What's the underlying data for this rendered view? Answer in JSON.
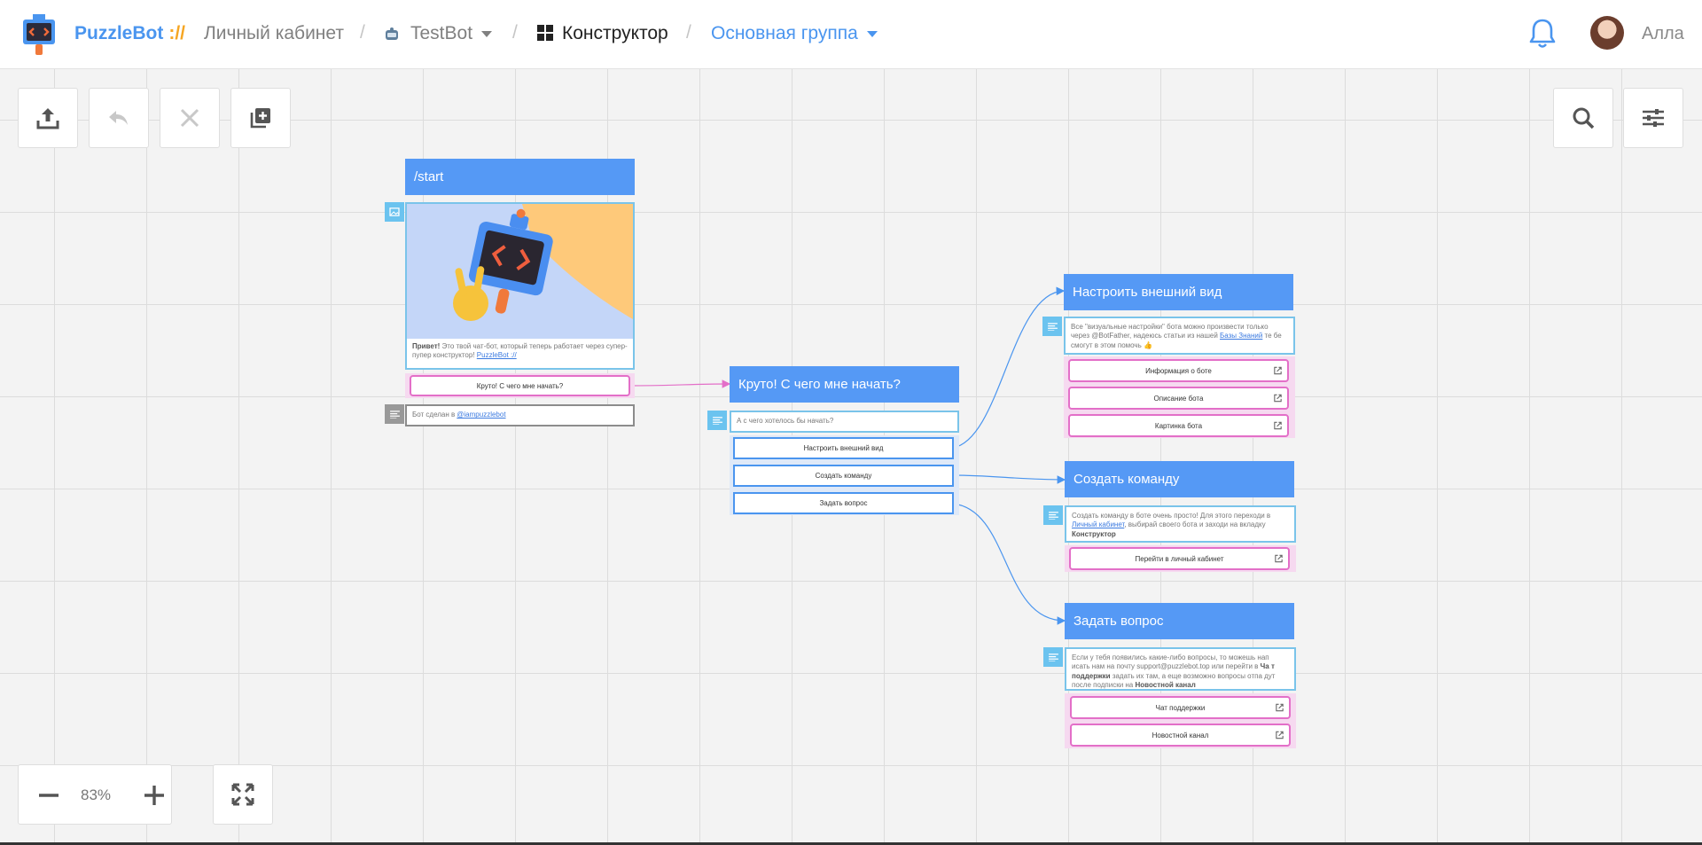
{
  "header": {
    "brand": "PuzzleBot",
    "brand_suffix": "://",
    "crumbs": {
      "cabinet": "Личный кабинет",
      "bot": "TestBot",
      "constructor": "Конструктор",
      "group": "Основная группа"
    },
    "user_name": "Алла"
  },
  "toolbar": {
    "icons": [
      "upload-icon",
      "undo-icon",
      "close-icon",
      "add-copy-icon"
    ],
    "right_icons": [
      "search-icon",
      "sliders-icon"
    ]
  },
  "zoom": {
    "level": "83%"
  },
  "blocks": {
    "start": {
      "title": "/start",
      "text_bold": "Привет!",
      "text": " Это твой чат-бот, который теперь работает через супер-пупер конструктор! ",
      "link": "PuzzleBot ://",
      "button": "Круто! С чего мне начать?",
      "footer_text": "Бот сделан в ",
      "footer_link": "@iampuzzlebot"
    },
    "begin": {
      "title": "Круто! С чего мне начать?",
      "text": "А с чего хотелось бы начать?",
      "buttons": [
        "Настроить внешний вид",
        "Создать команду",
        "Задать вопрос"
      ]
    },
    "appearance": {
      "title": "Настроить внешний вид",
      "text": "Все \"визуальные настройки\" бота можно произвести только через @BotFather, надеюсь статьи из нашей ",
      "link": "Базы Знаний",
      "text_after": " те бе смогут в этом помочь 👍",
      "buttons": [
        "Информация о боте",
        "Описание бота",
        "Картинка бота"
      ]
    },
    "command": {
      "title": "Создать команду",
      "text": "Создать команду в боте очень просто! Для этого переходи в ",
      "link": "Личный кабинет",
      "text_after": ", выбирай своего бота и заходи на вкладку ",
      "bold": "Конструктор",
      "buttons": [
        "Перейти в личный кабинет"
      ]
    },
    "question": {
      "title": "Задать вопрос",
      "text": "Если у тебя появились какие-либо вопросы, то можешь нап исать нам на почту support@puzzlebot.top или перейти в ",
      "bold1": "Ча т поддержки",
      "text_mid": " задать их там, а еще возможно вопросы отпа дут после подписки на ",
      "bold2": "Новостной канал",
      "buttons": [
        "Чат поддержки",
        "Новостной канал"
      ]
    }
  },
  "colors": {
    "accent": "#4a95ef",
    "block_header": "#5599f5",
    "message_border": "#7ac4ea",
    "button_pink": "#e36fc8",
    "logo_orange": "#f6a623"
  }
}
